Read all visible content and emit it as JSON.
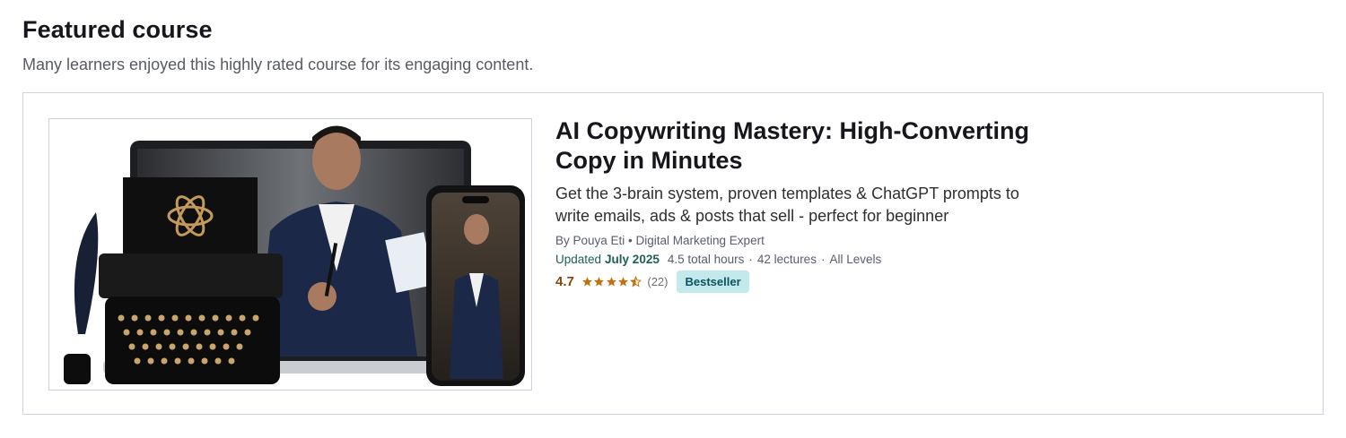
{
  "section": {
    "title": "Featured course",
    "subtitle": "Many learners enjoyed this highly rated course for its engaging content."
  },
  "course": {
    "title": "AI Copywriting Mastery: High-Converting Copy in Minutes",
    "headline": "Get the 3-brain system, proven templates & ChatGPT prompts to write emails, ads & posts that sell - perfect for beginner",
    "instructor": "By Pouya Eti • Digital Marketing Expert",
    "updated_label": "Updated",
    "updated_date": "July 2025",
    "hours": "4.5 total hours",
    "lectures": "42 lectures",
    "level": "All Levels",
    "rating": "4.7",
    "rating_stars": 4.5,
    "rating_count": "(22)",
    "badge": "Bestseller"
  },
  "colors": {
    "rating": "#8b4309",
    "star": "#c4710d",
    "badge_bg": "#c2e9eb",
    "updated": "#1e6055"
  },
  "icons": {
    "star": "star-icon",
    "half_star": "star-half-icon"
  }
}
